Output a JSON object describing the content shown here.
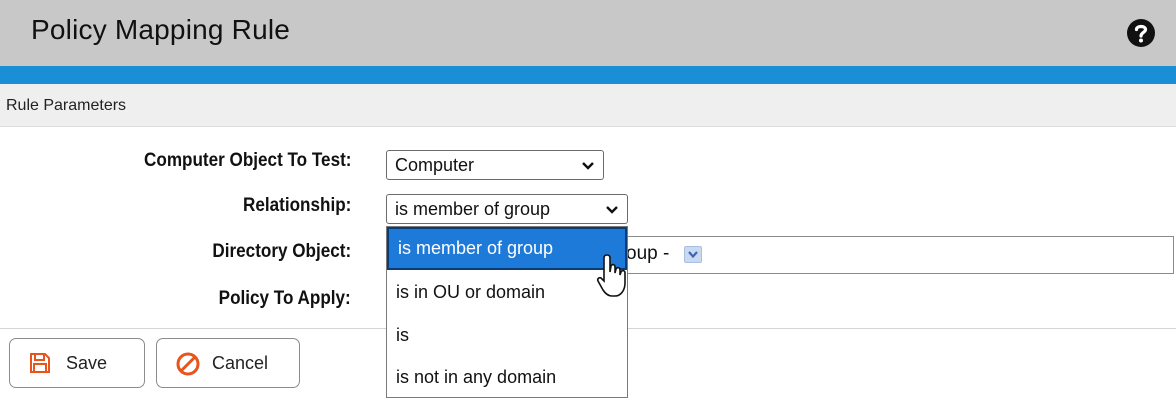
{
  "header": {
    "title": "Policy Mapping Rule",
    "help_icon": "question-circle-icon"
  },
  "colors": {
    "accent": "#1a8fd6",
    "selection": "#1e7ad8",
    "save_icon": "#e8541c",
    "cancel_icon": "#e8541c"
  },
  "section": {
    "title": "Rule Parameters"
  },
  "form": {
    "computer_object_label": "Computer Object To Test:",
    "computer_object_value": "Computer",
    "relationship_label": "Relationship:",
    "relationship_value": "is member of group",
    "directory_object_label": "Directory Object:",
    "directory_object_value_visible": "oup -",
    "policy_label": "Policy To Apply:"
  },
  "relationship_dropdown": {
    "options": [
      "is member of group",
      "is in OU or domain",
      "is",
      "is not in any domain"
    ],
    "selected_index": 0
  },
  "buttons": {
    "save_label": "Save",
    "cancel_label": "Cancel"
  }
}
